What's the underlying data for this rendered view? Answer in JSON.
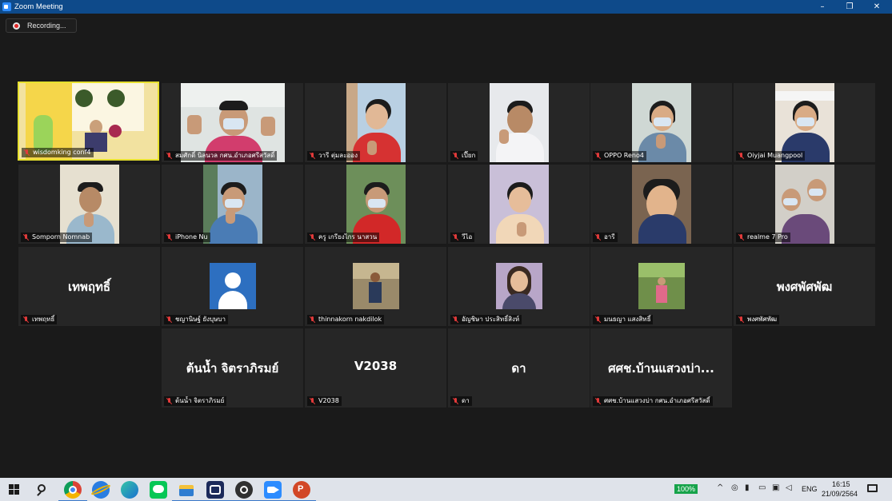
{
  "window": {
    "title": "Zoom Meeting",
    "minimize": "–",
    "restore": "❐",
    "close": "✕"
  },
  "recording": {
    "label": "Recording..."
  },
  "participants": [
    {
      "name": "wisdomking conf4",
      "kind": "video"
    },
    {
      "name": "สมศักดิ์ นิลนวล กศน.อำเภอศรีสวัสดิ์",
      "kind": "video"
    },
    {
      "name": "วารี ตุ่มละออง",
      "kind": "video"
    },
    {
      "name": "เปี๊ยก",
      "kind": "video"
    },
    {
      "name": "OPPO Reno4",
      "kind": "video"
    },
    {
      "name": "Oiyjai Muangpool",
      "kind": "video"
    },
    {
      "name": "Somporn Nomnab",
      "kind": "video"
    },
    {
      "name": "iPhone Nu",
      "kind": "video"
    },
    {
      "name": "ครู เกรียงไกร นาสวน",
      "kind": "video"
    },
    {
      "name": "วีไอ",
      "kind": "video"
    },
    {
      "name": "อารี",
      "kind": "video"
    },
    {
      "name": "realme 7 Pro",
      "kind": "video"
    },
    {
      "name": "เทพฤทธิ์",
      "display": "เทพฤทธิ์",
      "kind": "name"
    },
    {
      "name": "ชญานิษฐ์ ยังบุษบา",
      "kind": "avatar"
    },
    {
      "name": "thinnakorn nakdilok",
      "kind": "photo"
    },
    {
      "name": "อัญชิษา ประสิทธิ์สิงห์",
      "kind": "photo"
    },
    {
      "name": "มนธญา แสงสิทธิ์",
      "kind": "photo"
    },
    {
      "name": "พงศพัศพัฒ",
      "display": "พงศพัศพัฒ",
      "kind": "name"
    },
    {
      "name": "ต้นน้ำ จิตราภิรมย์",
      "display": "ต้นน้ำ จิตราภิรมย์",
      "kind": "name"
    },
    {
      "name": "V2038",
      "display": "V2038",
      "kind": "name"
    },
    {
      "name": "ดา",
      "display": "ดา",
      "kind": "name"
    },
    {
      "name": "ศศช.บ้านแสวงบ่า กศน.อำเภอศรีสวัสดิ์",
      "display": "ศศช.บ้านแสวงบ่า...",
      "kind": "name"
    }
  ],
  "taskbar": {
    "battery": "100%",
    "language": "ENG",
    "time": "16:15",
    "date": "21/09/2564",
    "apps": [
      "chrome",
      "internet-explorer",
      "edge",
      "line",
      "file-explorer",
      "app-w",
      "obs",
      "zoom",
      "powerpoint"
    ]
  },
  "colors": {
    "titlebar": "#0e4a8a",
    "active_speaker_border": "#e6e02e",
    "muted_mic": "#e23a3a",
    "tile_bg": "#262626"
  }
}
